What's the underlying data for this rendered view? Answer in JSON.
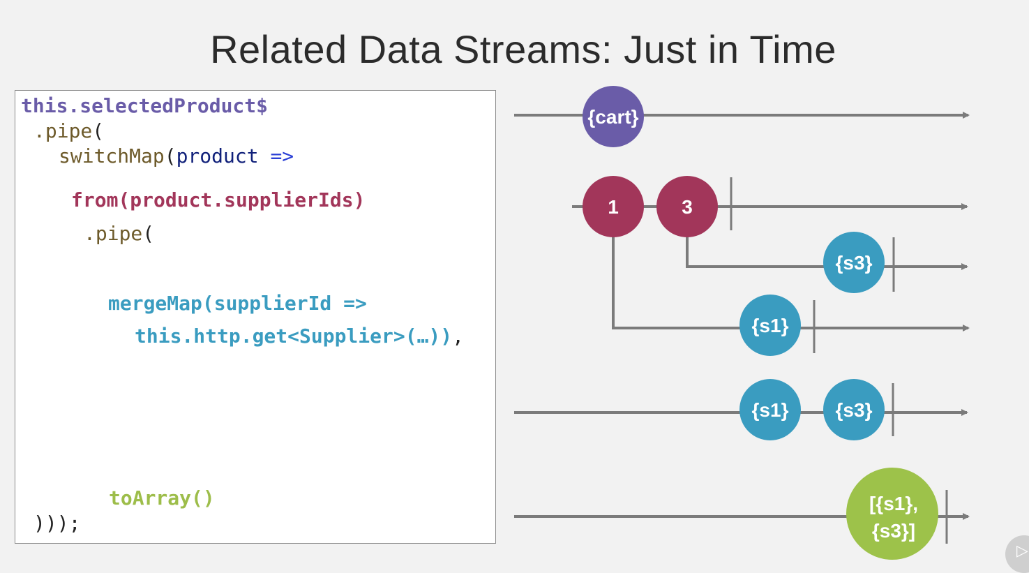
{
  "slide": {
    "title": "Related Data Streams: Just in Time"
  },
  "code": {
    "line1": "this.selectedProduct$",
    "line2_method": ".pipe",
    "line2_paren": "(",
    "line3_fn": "switchMap",
    "line3_paren": "(",
    "line3_arg": "product",
    "line3_arrow": "=>",
    "line4": "from(product.supplierIds)",
    "line5_method": ".pipe",
    "line5_paren": "(",
    "line6": "mergeMap(supplierId =>",
    "line7": "this.http.get<Supplier>(…))",
    "line7_comma": ",",
    "line8": "toArray()",
    "line9": ")));"
  },
  "diagram": {
    "colors": {
      "line": "#7b7b7b",
      "cart": "#6a5ca8",
      "id": "#a2365a",
      "supplier": "#3a9cc0",
      "array": "#9dc24a"
    },
    "marbles": {
      "cart": "{cart}",
      "id1": "1",
      "id3": "3",
      "s3_inner": "{s3}",
      "s1_inner": "{s1}",
      "s1_merged": "{s1}",
      "s3_merged": "{s3}",
      "array_line1": "[{s1},",
      "array_line2": "{s3}]"
    }
  },
  "badge": {
    "icon": "play-icon"
  }
}
